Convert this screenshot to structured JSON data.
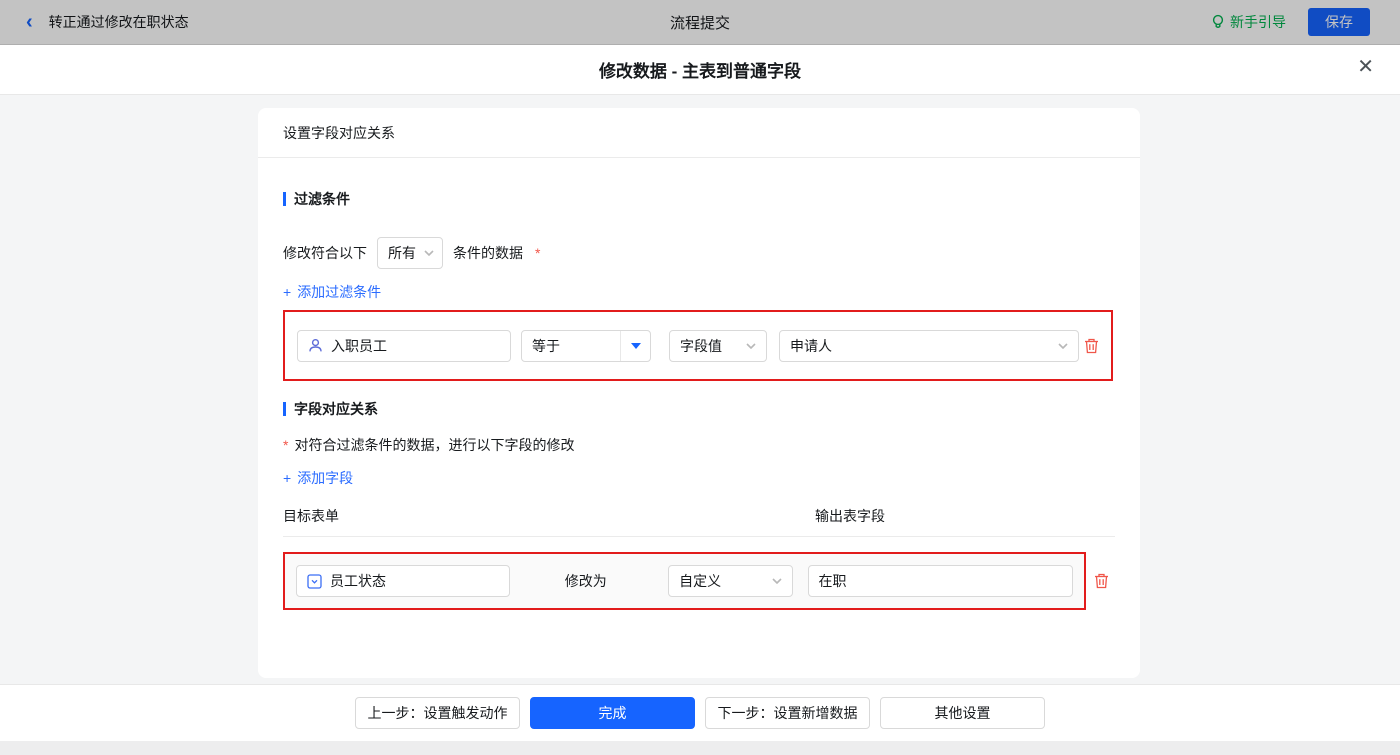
{
  "topbar": {
    "back_icon": "‹",
    "title": "转正通过修改在职状态",
    "center_title": "流程提交",
    "guide_label": "新手引导",
    "save_label": "保存"
  },
  "modal": {
    "title": "修改数据 - 主表到普通字段",
    "close_icon": "✕"
  },
  "card": {
    "header": "设置字段对应关系",
    "filter_section": {
      "title": "过滤条件",
      "match_prefix": "修改符合以下",
      "match_select_value": "所有",
      "match_suffix": "条件的数据",
      "required_mark": "*",
      "add_icon": "+",
      "add_label": "添加过滤条件",
      "condition_row": {
        "field": "入职员工",
        "operator": "等于",
        "value_type": "字段值",
        "value": "申请人"
      }
    },
    "mapping_section": {
      "title": "字段对应关系",
      "required_mark": "*",
      "description": "对符合过滤条件的数据，进行以下字段的修改",
      "add_icon": "+",
      "add_label": "添加字段",
      "columns": {
        "target": "目标表单",
        "output": "输出表字段"
      },
      "row": {
        "field": "员工状态",
        "action_label": "修改为",
        "mode": "自定义",
        "value": "在职"
      }
    }
  },
  "footer": {
    "prev_label": "上一步：设置触发动作",
    "done_label": "完成",
    "next_label": "下一步：设置新增数据",
    "other_label": "其他设置"
  },
  "colors": {
    "accent_blue": "#1664ff",
    "link_blue": "#2b6cff",
    "annotation_red": "#e21c1c",
    "danger_red": "#f2564a",
    "guide_green": "#00b14f"
  }
}
